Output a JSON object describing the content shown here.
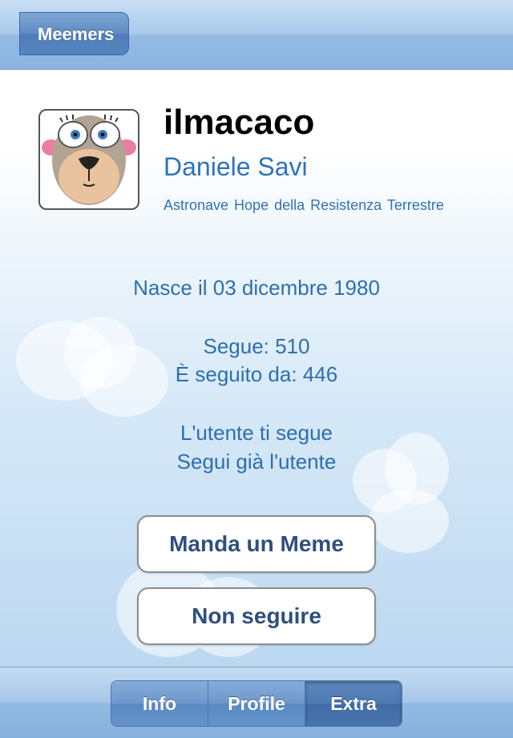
{
  "navbar": {
    "back_label": "Meemers"
  },
  "profile": {
    "avatar_icon": "monkey-face-icon",
    "username": "ilmacaco",
    "full_name": "Daniele Savi",
    "location": "Astronave Hope della Resistenza Terrestre"
  },
  "details": {
    "birth": "Nasce il 03 dicembre 1980",
    "following": "Segue: 510",
    "followers": "È seguito da: 446",
    "follows_you": "L'utente ti segue",
    "you_follow": "Segui già l'utente"
  },
  "actions": {
    "send_meme_label": "Manda un Meme",
    "unfollow_label": "Non seguire"
  },
  "toolbar": {
    "segments": [
      {
        "label": "Info",
        "selected": false
      },
      {
        "label": "Profile",
        "selected": false
      },
      {
        "label": "Extra",
        "selected": true
      }
    ]
  },
  "colors": {
    "accent_text": "#2d6fae",
    "button_text": "#2f4f7f",
    "bar_blue": "#8ab4e0"
  }
}
